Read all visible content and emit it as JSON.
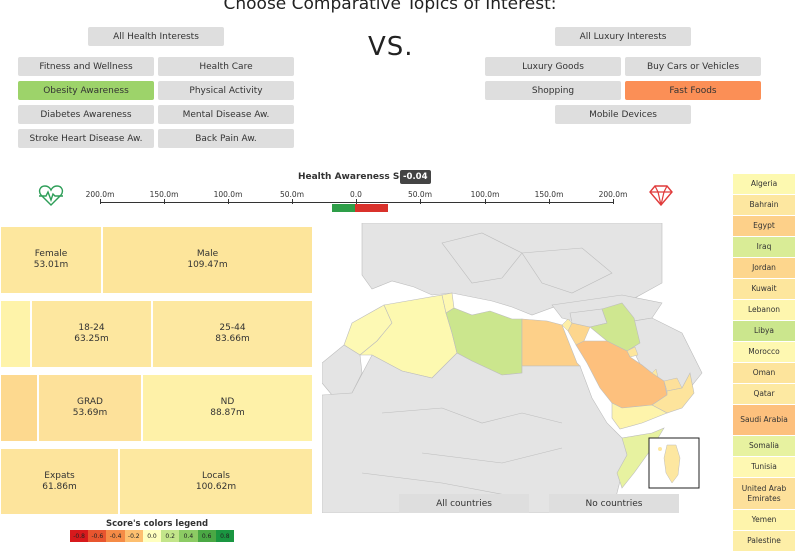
{
  "title": "Choose Comparative Topics of Interest:",
  "vs": "VS.",
  "health_buttons": {
    "all": "All Health Interests",
    "fitness": "Fitness and Wellness",
    "health_care": "Health Care",
    "obesity": "Obesity Awareness",
    "physical": "Physical Activity",
    "diabetes": "Diabetes Awareness",
    "mental": "Mental Disease Aw.",
    "stroke": "Stroke Heart Disease Aw.",
    "back_pain": "Back Pain Aw."
  },
  "luxury_buttons": {
    "all": "All Luxury Interests",
    "goods": "Luxury Goods",
    "cars": "Buy Cars or Vehicles",
    "shopping": "Shopping",
    "fast_foods": "Fast Foods",
    "mobile": "Mobile Devices"
  },
  "selected": {
    "health": "Obesity Awareness",
    "luxury": "Fast Foods"
  },
  "colors": {
    "health_selected": "#9dd36a",
    "luxury_selected": "#fb8f56",
    "button": "#dedede"
  },
  "score": {
    "label": "Health Awareness Score:",
    "value": "-0.04"
  },
  "axis_ticks": [
    "200.0m",
    "150.0m",
    "100.0m",
    "50.0m",
    "0.0",
    "50.0m",
    "100.0m",
    "150.0m",
    "200.0m"
  ],
  "icons": {
    "left": "heartbeat-icon",
    "right": "diamond-icon"
  },
  "treemap": {
    "gender": [
      {
        "label": "Female",
        "value": "53.01m"
      },
      {
        "label": "Male",
        "value": "109.47m"
      }
    ],
    "age": [
      {
        "label": "18-24",
        "value": "63.25m"
      },
      {
        "label": "25-44",
        "value": "83.66m"
      }
    ],
    "education": [
      {
        "label": "GRAD",
        "value": "53.69m"
      },
      {
        "label": "ND",
        "value": "88.87m"
      }
    ],
    "residency": [
      {
        "label": "Expats",
        "value": "61.86m"
      },
      {
        "label": "Locals",
        "value": "100.62m"
      }
    ]
  },
  "legend": {
    "title": "Score's colors legend",
    "values": [
      "-0.8",
      "-0.6",
      "-0.4",
      "-0.2",
      "0.0",
      "0.2",
      "0.4",
      "0.6",
      "0.8"
    ],
    "colors": [
      "#d7191c",
      "#e8552f",
      "#f58b46",
      "#fdbf6f",
      "#ffffbf",
      "#c3e58a",
      "#8ccb64",
      "#4aa844",
      "#1a9641"
    ]
  },
  "map_buttons": {
    "all": "All countries",
    "none": "No countries"
  },
  "countries": [
    {
      "name": "Algeria",
      "color": "#fdf9b0"
    },
    {
      "name": "Bahrain",
      "color": "#fde7a0"
    },
    {
      "name": "Egypt",
      "color": "#fdd089"
    },
    {
      "name": "Iraq",
      "color": "#d9ec96"
    },
    {
      "name": "Jordan",
      "color": "#fdd68d"
    },
    {
      "name": "Kuwait",
      "color": "#fde69d"
    },
    {
      "name": "Lebanon",
      "color": "#fef6ae"
    },
    {
      "name": "Libya",
      "color": "#cbe68d"
    },
    {
      "name": "Morocco",
      "color": "#fef8b1"
    },
    {
      "name": "Oman",
      "color": "#fde49c"
    },
    {
      "name": "Qatar",
      "color": "#fde9a2"
    },
    {
      "name": "Saudi Arabia",
      "color": "#fdc07d"
    },
    {
      "name": "Somalia",
      "color": "#e7f2a0"
    },
    {
      "name": "Tunisia",
      "color": "#fef8b2"
    },
    {
      "name": "United Arab Emirates",
      "color": "#fde09a"
    },
    {
      "name": "Yemen",
      "color": "#fef4ab"
    },
    {
      "name": "Palestine",
      "color": "#fdeea7"
    }
  ]
}
